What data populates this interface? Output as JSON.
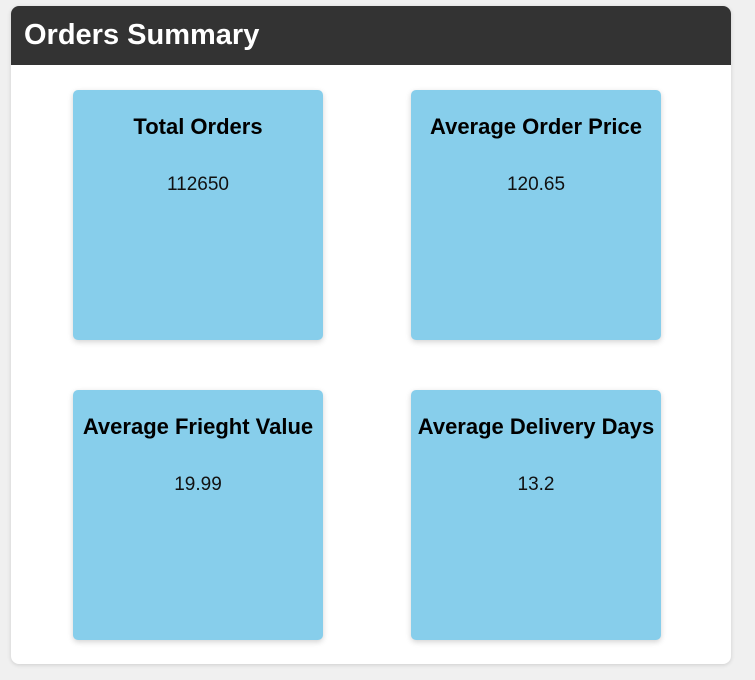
{
  "panel": {
    "title": "Orders Summary"
  },
  "cards": [
    {
      "title": "Total Orders",
      "value": "112650"
    },
    {
      "title": "Average Order Price",
      "value": "120.65"
    },
    {
      "title": "Average Frieght Value",
      "value": "19.99"
    },
    {
      "title": "Average Delivery Days",
      "value": "13.2"
    }
  ],
  "colors": {
    "header_bg": "#333333",
    "card_bg": "#87ceeb",
    "panel_bg": "#ffffff",
    "page_bg": "#f0f0f0"
  }
}
